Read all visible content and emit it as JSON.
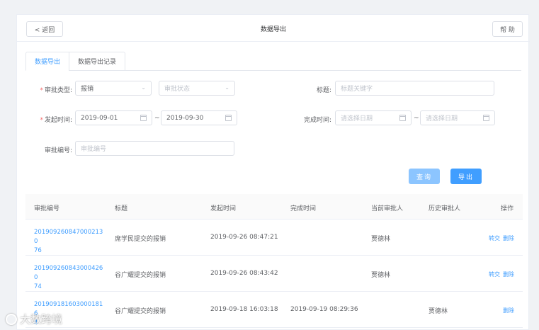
{
  "header": {
    "back_label": "< 返回",
    "title": "数据导出",
    "help_label": "帮 助"
  },
  "tabs": [
    {
      "label": "数据导出"
    },
    {
      "label": "数据导出记录"
    }
  ],
  "form": {
    "approval_type": {
      "label": "审批类型:",
      "value": "报销",
      "status_placeholder": "审批状态"
    },
    "subject": {
      "label": "标题:",
      "placeholder": "标题关键字"
    },
    "start_time": {
      "label": "发起时间:",
      "from": "2019-09-01",
      "to": "2019-09-30"
    },
    "finish_time": {
      "label": "完成时间:",
      "from_placeholder": "请选择日期",
      "to_placeholder": "请选择日期"
    },
    "approval_no": {
      "label": "审批编号:",
      "placeholder": "审批编号"
    },
    "required_mark": "*",
    "tilde": "~"
  },
  "actions": {
    "query_label": "查询",
    "export_label": "导出"
  },
  "table": {
    "columns": [
      "审批编号",
      "标题",
      "发起时间",
      "完成时间",
      "当前审批人",
      "历史审批人",
      "操作"
    ],
    "rows": [
      {
        "id": "201909260847000213076",
        "id_l1": "2019092608470002130",
        "id_l2": "76",
        "title": "席学民提交的报销",
        "start": "2019-09-26 08:47:21",
        "finish": "",
        "current": "贾德林",
        "history": "",
        "op1": "转交",
        "op2": "删除"
      },
      {
        "id": "201909260843000426074",
        "id_l1": "2019092608430004260",
        "id_l2": "74",
        "title": "谷广耀提交的报销",
        "start": "2019-09-26 08:43:42",
        "finish": "",
        "current": "贾德林",
        "history": "",
        "op1": "转交",
        "op2": "删除"
      },
      {
        "id": "20190918160300018164",
        "id_l1": "2019091816030001816",
        "id_l2": "4",
        "title": "谷广耀提交的报销",
        "start": "2019-09-18 16:03:18",
        "finish": "2019-09-19 08:29:36",
        "current": "",
        "history": "贾德林",
        "op1": "",
        "op2": "删除"
      }
    ]
  },
  "watermark": "大数跨境"
}
